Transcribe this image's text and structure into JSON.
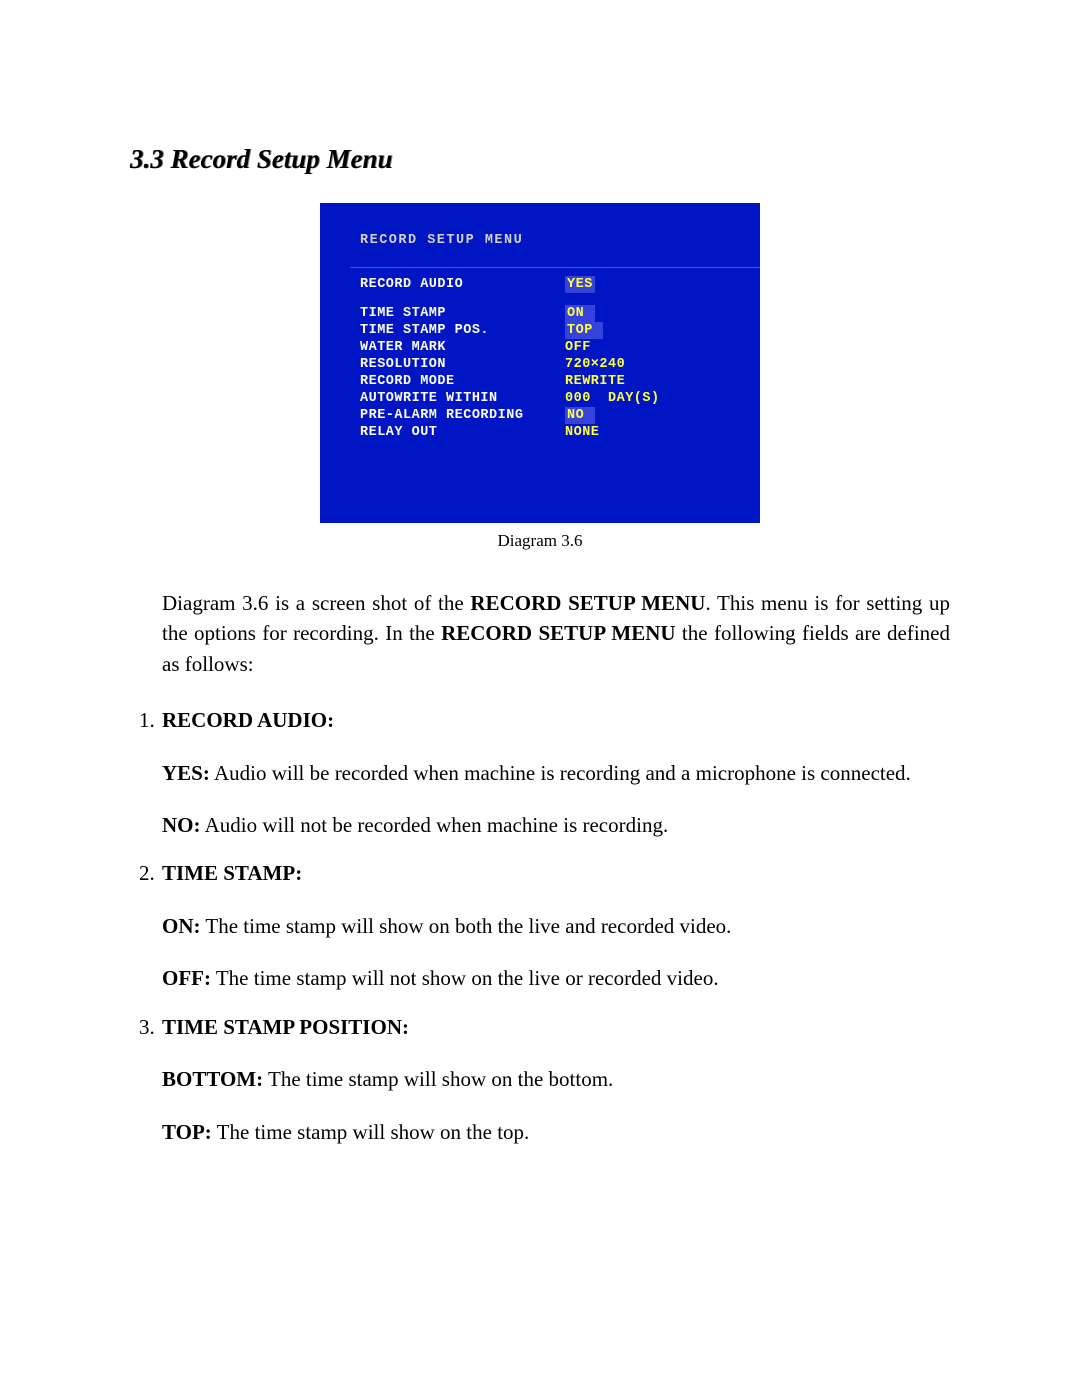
{
  "title": "3.3 Record Setup Menu",
  "screenshot": {
    "menu_title": "RECORD SETUP MENU",
    "rows": [
      {
        "label": "RECORD AUDIO",
        "value": "YES",
        "sel": true
      },
      {
        "spacer": true
      },
      {
        "label": "TIME STAMP",
        "value": "ON ",
        "sel": true
      },
      {
        "label": "TIME STAMP POS.",
        "value": "TOP ",
        "sel": true
      },
      {
        "label": "WATER MARK",
        "value": "OFF",
        "sel": false
      },
      {
        "label": "RESOLUTION",
        "value": "720×240",
        "sel": false
      },
      {
        "label": "RECORD MODE",
        "value": "REWRITE",
        "sel": false
      },
      {
        "label": "AUTOWRITE WITHIN",
        "value": "000  DAY(S)",
        "sel": false
      },
      {
        "label": "PRE-ALARM RECORDING",
        "value": "NO ",
        "sel": true
      },
      {
        "label": "RELAY OUT",
        "value": "NONE",
        "sel": false
      }
    ]
  },
  "caption": "Diagram 3.6",
  "intro_prefix": "Diagram 3.6 is a screen shot of the ",
  "intro_bold1": "RECORD SETUP MENU",
  "intro_mid": ". This menu is for setting up the options for recording. In the ",
  "intro_bold2": "RECORD SETUP MENU",
  "intro_suffix": " the following fields are defined as follows:",
  "fields": [
    {
      "name": "RECORD AUDIO:",
      "opts": [
        {
          "k": "YES:",
          "v": " Audio will be recorded when machine is recording and a microphone is connected."
        },
        {
          "k": "NO:",
          "v": " Audio will not be recorded when machine is recording."
        }
      ]
    },
    {
      "name": "TIME STAMP:",
      "opts": [
        {
          "k": "ON:",
          "v": " The time stamp will show on both the live and recorded video."
        },
        {
          "k": "OFF:",
          "v": " The time stamp will not show on the live or recorded video."
        }
      ]
    },
    {
      "name": "TIME STAMP POSITION:",
      "opts": [
        {
          "k": "BOTTOM:",
          "v": " The time stamp will show on the bottom."
        },
        {
          "k": "TOP:",
          "v": " The time stamp will show on the top."
        }
      ]
    }
  ]
}
